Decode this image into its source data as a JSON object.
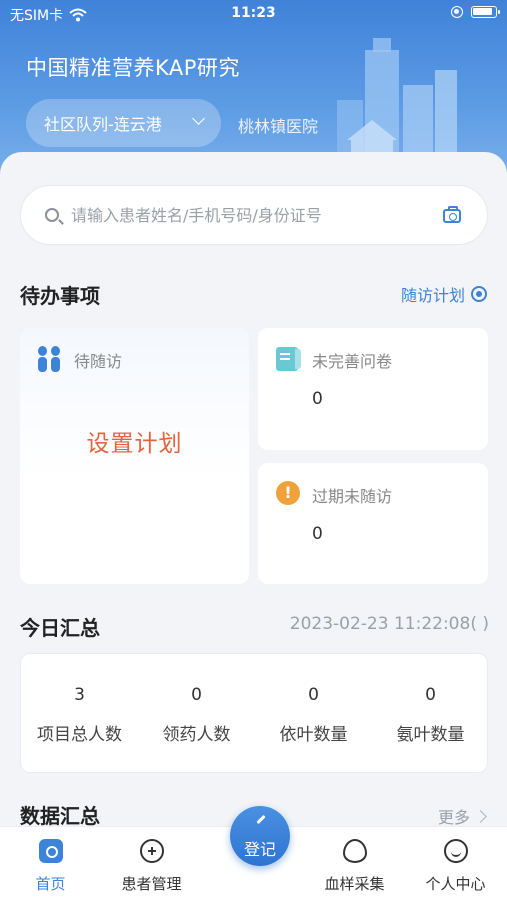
{
  "status_bar": {
    "carrier": "无SIM卡",
    "time": "11:23"
  },
  "header": {
    "title": "中国精准营养KAP研究",
    "team_select": "社区队列-连云港",
    "hospital": "桃林镇医院"
  },
  "search": {
    "placeholder": "请输入患者姓名/手机号码/身份证号"
  },
  "todo": {
    "title": "待办事项",
    "plan_link": "随访计划",
    "pending_followup": {
      "label": "待随访",
      "action": "设置计划"
    },
    "incomplete_questionnaire": {
      "label": "未完善问卷",
      "value": "0"
    },
    "overdue": {
      "label": "过期未随访",
      "value": "0"
    }
  },
  "today": {
    "title": "今日汇总",
    "datetime": "2023-02-23 11:22:08",
    "stats": [
      {
        "value": "3",
        "label": "项目总人数"
      },
      {
        "value": "0",
        "label": "领药人数"
      },
      {
        "value": "0",
        "label": "依叶数量"
      },
      {
        "value": "0",
        "label": "氨叶数量"
      }
    ]
  },
  "data_summary": {
    "title": "数据汇总",
    "more": "更多"
  },
  "tabbar": {
    "home": "首页",
    "patients": "患者管理",
    "register": "登记",
    "blood": "血样采集",
    "profile": "个人中心"
  },
  "colors": {
    "primary": "#3d83d8",
    "accent": "#e2633f",
    "warning": "#f0a13a"
  }
}
